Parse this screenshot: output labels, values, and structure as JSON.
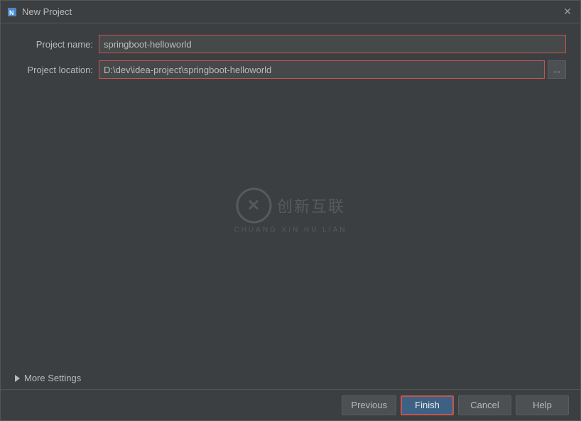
{
  "titlebar": {
    "title": "New Project",
    "close_label": "✕"
  },
  "form": {
    "project_name_label": "Project name:",
    "project_name_value": "springboot-helloworld",
    "project_location_label": "Project location:",
    "project_location_value": "D:\\dev\\idea-project\\springboot-helloworld",
    "browse_label": "...",
    "more_settings_label": "More Settings"
  },
  "watermark": {
    "symbol": "✕",
    "text_big": "创新互联",
    "text_small": "CHUANG XIN HU LIAN"
  },
  "footer": {
    "previous_label": "Previous",
    "finish_label": "Finish",
    "cancel_label": "Cancel",
    "help_label": "Help"
  }
}
